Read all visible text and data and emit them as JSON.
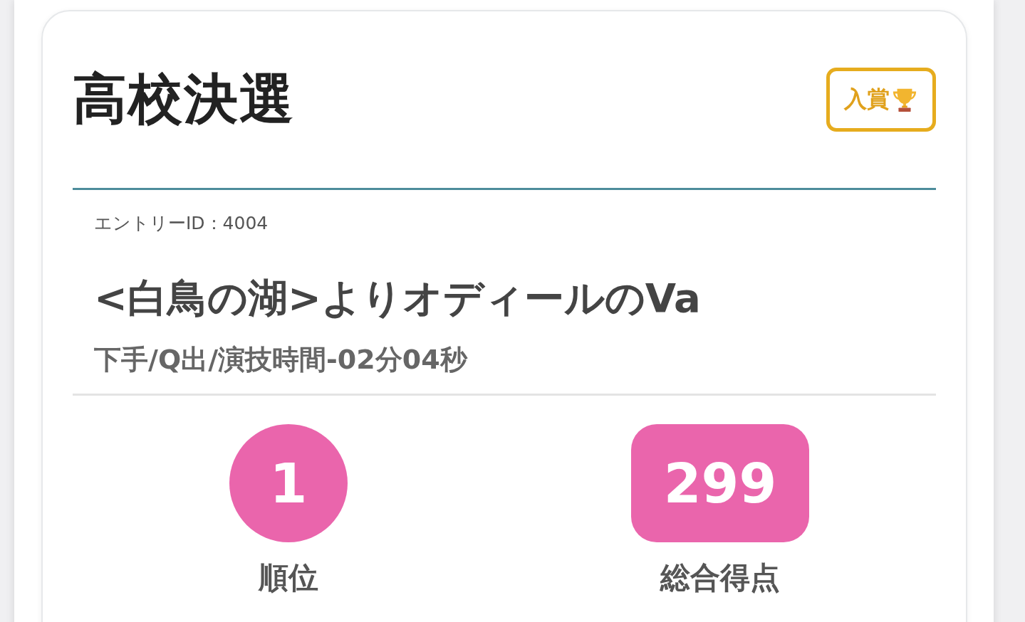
{
  "card": {
    "title": "高校決選",
    "badge": {
      "label": "入賞"
    },
    "entry_id": "エントリーID：4004",
    "piece_title": "<白鳥の湖>よりオディールのVa",
    "details": "下手/Q出/演技時間-02分04秒",
    "stats": [
      {
        "kind": "circle",
        "value": "1",
        "label": "順位"
      },
      {
        "kind": "pill",
        "value": "299",
        "label": "総合得点"
      }
    ]
  }
}
